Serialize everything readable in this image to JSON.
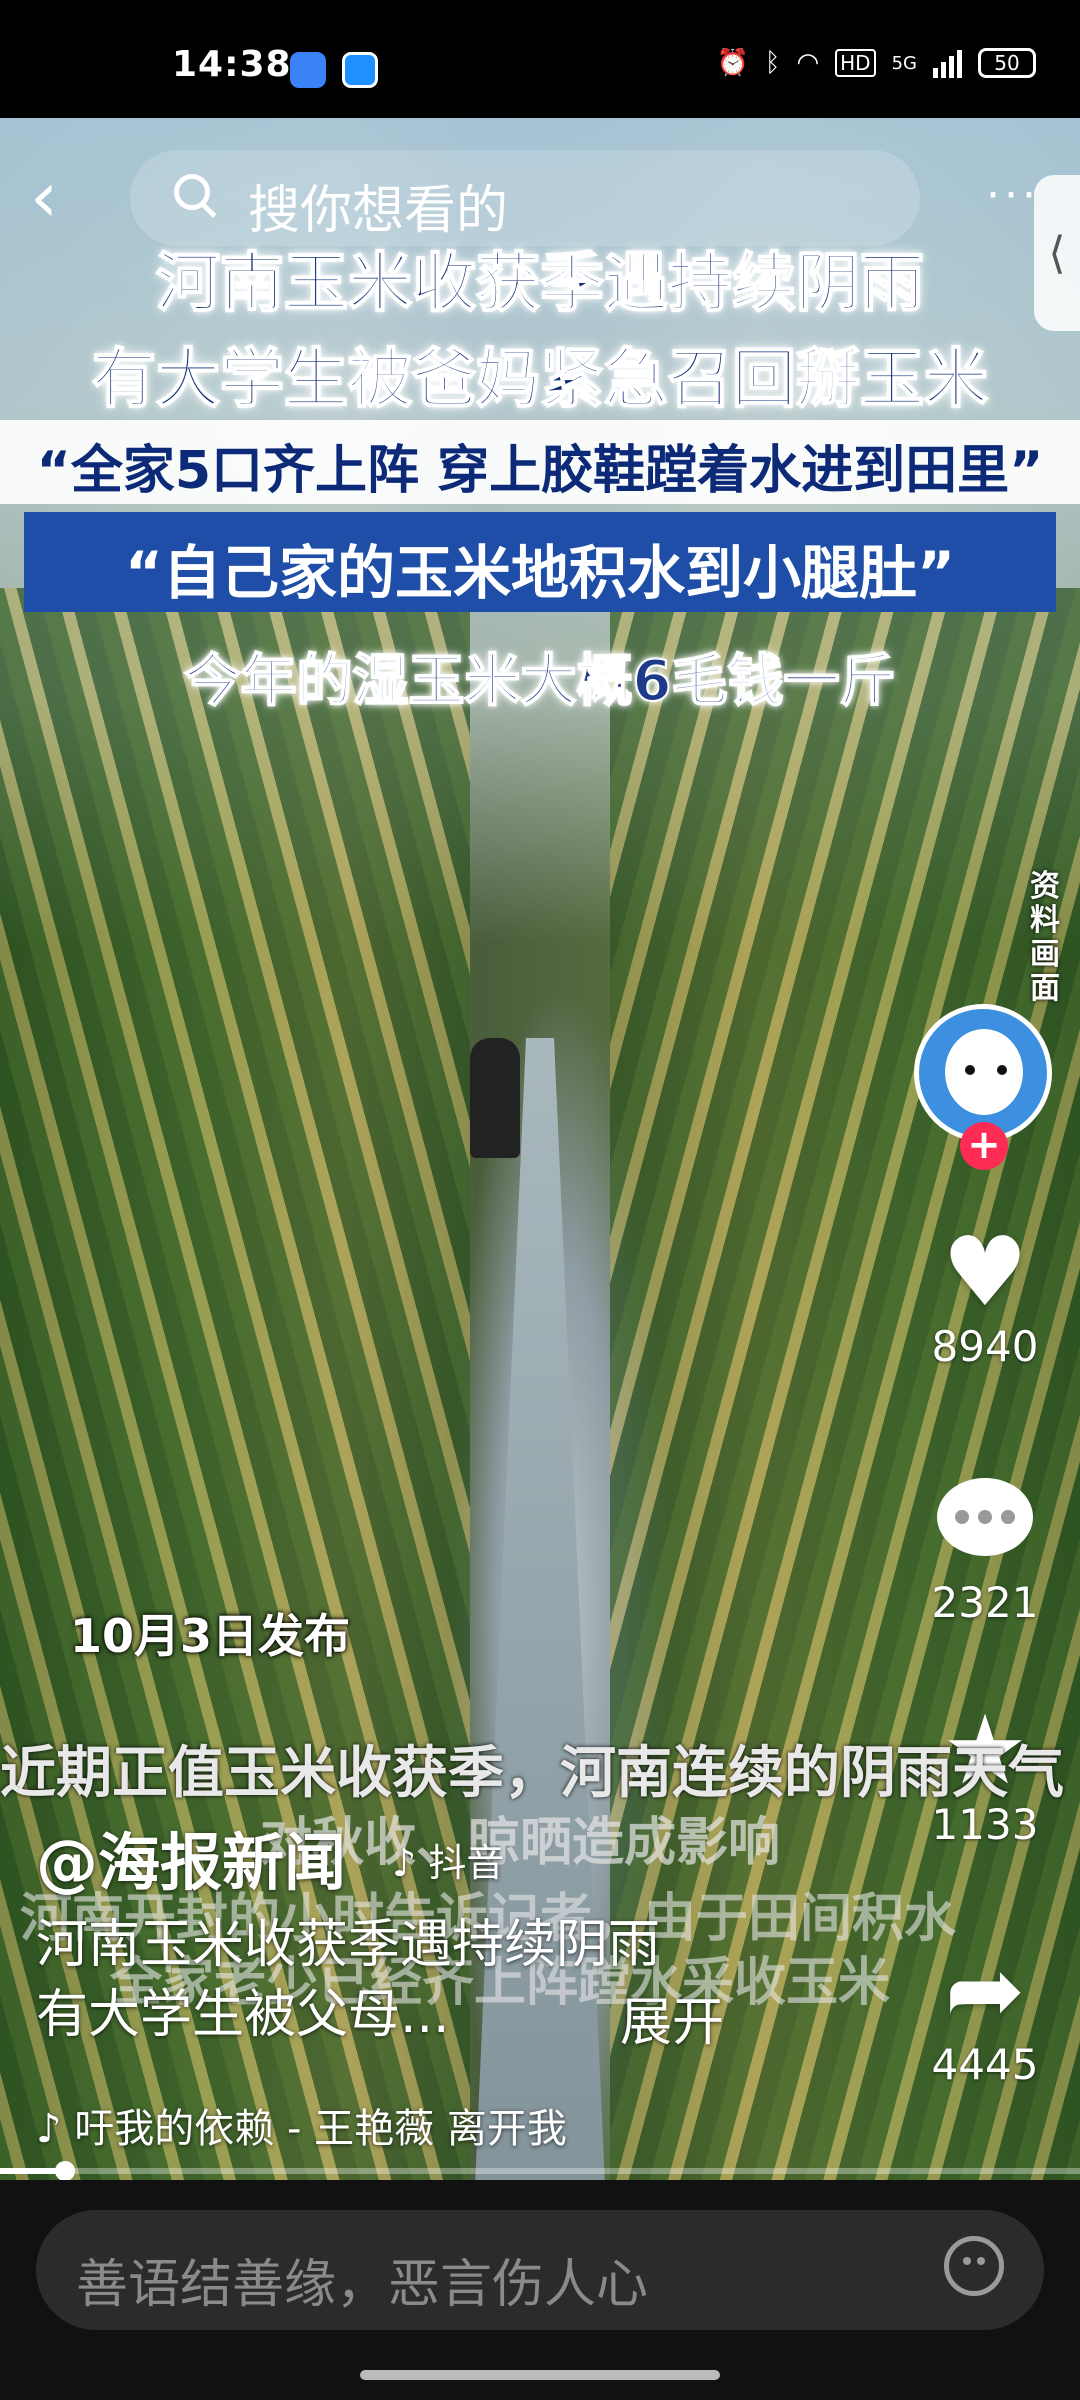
{
  "status_bar": {
    "time": "14:38",
    "battery": "50",
    "hd": "HD",
    "net": "5G"
  },
  "top": {
    "search_placeholder": "搜你想看的",
    "more": "···"
  },
  "video_overlay": {
    "line1": "河南玉米收获季遇持续阴雨",
    "line2": "有大学生被爸妈紧急召回掰玉米",
    "line3": "“全家5口齐上阵 穿上胶鞋蹚着水进到田里”",
    "line4": "“自己家的玉米地积水到小腿肚”",
    "line5": "今年的湿玉米大概6毛钱一斤",
    "label_vertical": "资料画面",
    "date": "10月3日发布",
    "sub1": "近期正值玉米收获季，河南连续的阴雨天气",
    "sub2": "对秋收、晾晒造成影响",
    "sub3": "河南开封的小时告诉记者，由于田间积水",
    "sub4": "全家老少已经齐上阵蹚水采收玉米"
  },
  "actions": {
    "likes": "8940",
    "comments": "2321",
    "favorites": "1133",
    "shares": "4445"
  },
  "post": {
    "author": "@海报新闻",
    "platform": "♪ 抖音",
    "desc_line1": "河南玉米收获季遇持续阴雨",
    "desc_line2": "有大学生被父母...",
    "expand": "展开",
    "music": "♪ 吁我的依赖 - 王艳薇   离开我"
  },
  "progress": {
    "fraction": 0.06
  },
  "comment_bar": {
    "placeholder": "善语结善缘，恶言伤人心"
  }
}
